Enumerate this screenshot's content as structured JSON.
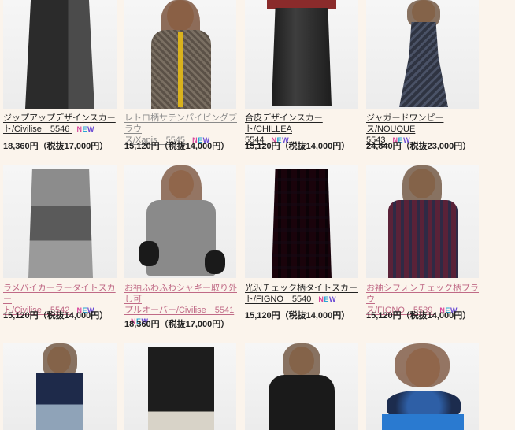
{
  "new_badge": {
    "n": "N",
    "e": "E",
    "w": "W"
  },
  "products": [
    {
      "title_part1": "ジップアップデザインスカー",
      "title_part2": "ト/Civilise　5546",
      "price": "18,360円（税抜17,000円）",
      "title_color": "dark"
    },
    {
      "title_part1": "レトロ柄サテンパイピングブラウ",
      "title_part2": "ス/Xapis　5545",
      "price": "15,120円（税抜14,000円）",
      "title_color": "gray"
    },
    {
      "title_part1": "合皮デザインスカート/CHILLEA",
      "title_part2": "5544",
      "price": "15,120円（税抜14,000円）",
      "title_color": "dark"
    },
    {
      "title_part1": "ジャガードワンピース/NOUQUE",
      "title_part2": "5543",
      "price": "24,840円（税抜23,000円）",
      "title_color": "dark"
    },
    {
      "title_part1": "ラメバイカーラータイトスカー",
      "title_part2": "ト/Civilise　5542",
      "price": "15,120円（税抜14,000円）",
      "title_color": "pink"
    },
    {
      "title_part1": "お袖ふわふわシャギー取り外し可",
      "title_part2": "プルオーバー/Civilise　5541",
      "price": "18,360円（税抜17,000円）",
      "title_color": "pink"
    },
    {
      "title_part1": "光沢チェック柄タイトスカー",
      "title_part2": "ト/FIGNO　5540",
      "price": "15,120円（税抜14,000円）",
      "title_color": "dark"
    },
    {
      "title_part1": "お袖シフォンチェック柄ブラウ",
      "title_part2": "ス/FIGNO　5539",
      "price": "15,120円（税抜14,000円）",
      "title_color": "pink"
    }
  ]
}
